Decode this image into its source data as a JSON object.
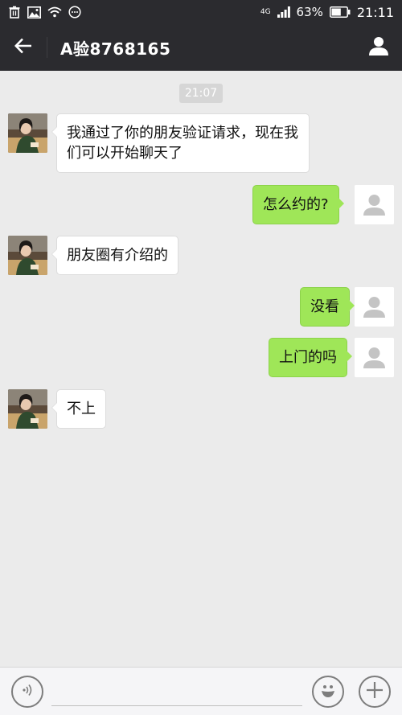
{
  "status_bar": {
    "network": "4G",
    "battery_percent": "63%",
    "battery_level": 0.63,
    "time": "21:11",
    "icons": [
      "trash-icon",
      "image-icon",
      "wifi-icon",
      "more-icon",
      "signal-icon",
      "battery-icon"
    ]
  },
  "nav": {
    "title": "A验8768165",
    "back_icon": "arrow-left-icon",
    "profile_icon": "person-icon"
  },
  "chat": {
    "timestamp": "21:07",
    "messages": [
      {
        "direction": "in",
        "text": "我通过了你的朋友验证请求，现在我们可以开始聊天了"
      },
      {
        "direction": "out",
        "text": "怎么约的?"
      },
      {
        "direction": "in",
        "text": "朋友圈有介绍的"
      },
      {
        "direction": "out",
        "text": "没看"
      },
      {
        "direction": "out",
        "text": "上门的吗"
      },
      {
        "direction": "in",
        "text": "不上"
      }
    ]
  },
  "input_bar": {
    "placeholder": "",
    "icons": [
      "voice-icon",
      "emoji-icon",
      "plus-icon"
    ]
  },
  "colors": {
    "header_bg": "#2b2b2f",
    "chat_bg": "#ebebeb",
    "bubble_out": "#9fe658",
    "bubble_in": "#ffffff"
  }
}
